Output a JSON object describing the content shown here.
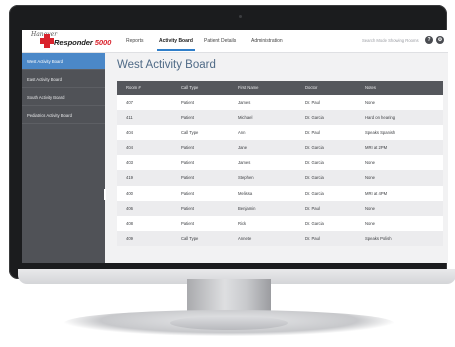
{
  "logo": {
    "script_text": "Hanover",
    "brand_name": "Responder",
    "brand_number": "5000",
    "icon": "red-cross-icon"
  },
  "nav": {
    "tabs": [
      {
        "label": "Reports"
      },
      {
        "label": "Activity Board",
        "active": true
      },
      {
        "label": "Patient Details"
      },
      {
        "label": "Administration"
      }
    ],
    "search_text": "Search Mode Showing Rooms",
    "help_icon_glyph": "?",
    "settings_icon_glyph": "⚙",
    "accent_color": "#2f7ec9"
  },
  "sidebar": {
    "items": [
      {
        "label": "West Activity Board",
        "active": true
      },
      {
        "label": "East Activity Board"
      },
      {
        "label": "South Activity Board"
      },
      {
        "label": "Pediatrics Activity Board"
      }
    ],
    "collapse_glyph": "‹"
  },
  "main": {
    "title": "West Activity Board",
    "columns": [
      "Room #",
      "Call Type",
      "First Name",
      "Doctor",
      "Notes"
    ],
    "rows": [
      [
        "407",
        "Patient",
        "James",
        "Dr. Paul",
        "None"
      ],
      [
        "411",
        "Patient",
        "Michael",
        "Dr. Garcia",
        "Hard on hearing"
      ],
      [
        "404",
        "Call Type",
        "Ann",
        "Dr. Paul",
        "Speaks Spanish"
      ],
      [
        "404",
        "Patient",
        "Jane",
        "Dr. Garcia",
        "MRI at 2PM"
      ],
      [
        "403",
        "Patient",
        "James",
        "Dr. Garcia",
        "None"
      ],
      [
        "419",
        "Patient",
        "Stephen",
        "Dr. Garcia",
        "None"
      ],
      [
        "400",
        "Patient",
        "Melissa",
        "Dr. Garcia",
        "MRI at 4PM"
      ],
      [
        "406",
        "Patient",
        "Benjamin",
        "Dr. Paul",
        "None"
      ],
      [
        "408",
        "Patient",
        "Rick",
        "Dr. Garcia",
        "None"
      ],
      [
        "409",
        "Call Type",
        "Annete",
        "Dr. Paul",
        "Speaks Polish"
      ]
    ]
  }
}
